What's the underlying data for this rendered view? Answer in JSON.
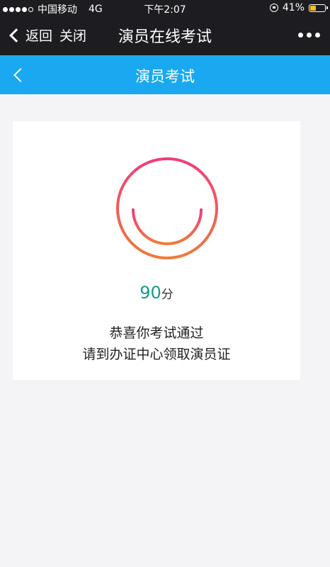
{
  "status_bar": {
    "carrier": "中国移动",
    "network": "4G",
    "time": "下午2:07",
    "battery_percent": "41%",
    "battery_level": 0.41,
    "signal_bars": 4,
    "signal_max": 5
  },
  "wechat_nav": {
    "back_label": "返回",
    "close_label": "关闭",
    "title": "演员在线考试"
  },
  "app_header": {
    "title": "演员考试",
    "color": "#1aa9f0"
  },
  "result": {
    "score": "90",
    "score_unit": "分",
    "message_line1": "恭喜你考试通过",
    "message_line2": "请到办证中心领取演员证",
    "score_color": "#159b8c",
    "smiley_gradient": [
      "#ee3e79",
      "#f07a3c"
    ]
  },
  "icons": {
    "back": "chevron-left-icon",
    "more": "more-dots-icon",
    "smiley": "smiley-face-icon",
    "lock": "rotation-lock-icon",
    "battery": "battery-icon"
  }
}
